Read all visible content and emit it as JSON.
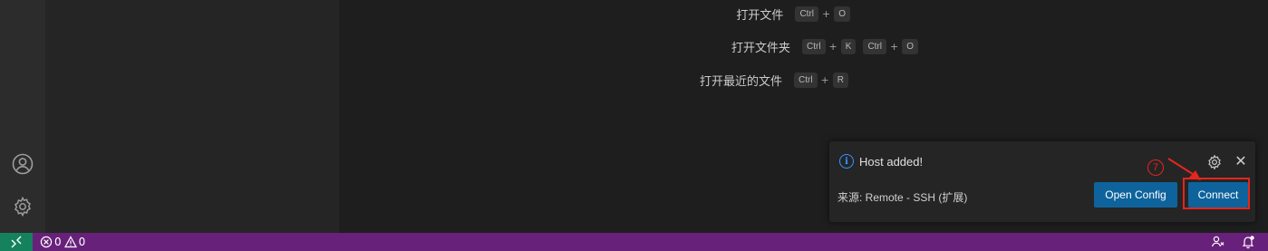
{
  "shortcuts": [
    {
      "label": "打开文件",
      "combos": [
        [
          "Ctrl",
          "O"
        ]
      ]
    },
    {
      "label": "打开文件夹",
      "combos": [
        [
          "Ctrl",
          "K"
        ],
        [
          "Ctrl",
          "O"
        ]
      ]
    },
    {
      "label": "打开最近的文件",
      "combos": [
        [
          "Ctrl",
          "R"
        ]
      ]
    }
  ],
  "plus": "+",
  "notification": {
    "message": "Host added!",
    "info_icon": "i",
    "source": "来源: Remote - SSH (扩展)",
    "open_config_label": "Open Config",
    "connect_label": "Connect",
    "close_glyph": "✕",
    "annotation_number": "7"
  },
  "statusbar": {
    "errors": "0",
    "warnings": "0"
  },
  "colors": {
    "statusbar_bg": "#68217a",
    "remote_bg": "#16825d",
    "button_bg": "#0e639c",
    "annotation_red": "#e5261b",
    "info_blue": "#3794ff"
  },
  "icons": {
    "activity_account": "account-icon",
    "activity_manage": "gear-icon",
    "remote": "remote-icon",
    "error": "error-icon",
    "warning": "warning-icon",
    "accounts_status": "accounts-icon",
    "notifications": "bell-icon"
  }
}
